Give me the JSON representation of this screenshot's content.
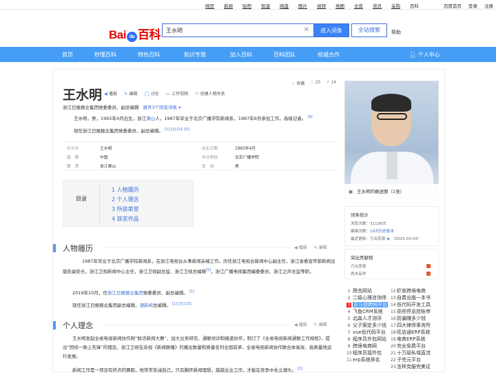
{
  "topbar": {
    "links": [
      "网页",
      "新闻",
      "贴吧",
      "知道",
      "网盘",
      "图片",
      "视频",
      "地图",
      "文库",
      "资讯",
      "采购",
      "百科"
    ],
    "right": [
      "百度首页",
      "登录",
      "注册"
    ]
  },
  "header": {
    "logo_text": "Bai",
    "logo_paw": "du",
    "logo_tail": "百科",
    "search_value": "王水明",
    "enter_label": "进入词条",
    "site_search_label": "全站搜索",
    "help_label": "帮助"
  },
  "nav": {
    "items": [
      "首页",
      "秒懂百科",
      "特色百科",
      "知识专题",
      "加入百科",
      "百科团队",
      "权威合作"
    ],
    "user": "个人中心"
  },
  "entry": {
    "title": "王水明",
    "tools": [
      "播报",
      "编辑",
      "讨论",
      "上传视频",
      "创建人物关系"
    ],
    "favorite": "收藏",
    "likes": "25",
    "shares": "14",
    "subtitle": "浙江日报报业集团党委委员、副总编辑",
    "same_name": "展开3个同名词条",
    "intro_1": "王水明，男，1965年4月出生，浙江",
    "intro_link": "萧山",
    "intro_2": "人，1987年毕业于北京广播学院新闻系，1987年8月参加工作。高级记者。",
    "intro_ref": "[4]",
    "intro_line2": "现任浙江日报报业集团党委委员、副总编辑。",
    "intro_line2_refs": "[1]  [3]  [13-15]"
  },
  "info": {
    "rows": [
      {
        "k1": "中文名",
        "v1": "王水明",
        "k2": "出生日期",
        "v2": "1965年4月"
      },
      {
        "k1": "国　籍",
        "v1": "中国",
        "k2": "毕业院校",
        "v2": "北京广播学院"
      },
      {
        "k1": "籍　贯",
        "v1": "浙江萧山",
        "k2": "性　别",
        "v2": "男"
      }
    ]
  },
  "toc": {
    "label": "目录",
    "items": [
      "1  人物履历",
      "2  个人理念",
      "3  所获荣誉",
      "4  获奖作品"
    ]
  },
  "sections": {
    "s1_title": "人物履历",
    "s1_p1": "1987年毕业于北京广播学院新闻系，在浙江电视台从事新闻采编工作。历任浙江电视台新闻中心副主任，浙江省委宣传部新闻出版处副处长，浙江卫视新闻中心主任，浙江卫视副总监、浙江卫视总编辑",
    "s1_p1_ref": "[5]",
    "s1_p1_tail": "，浙江广播电视集团编委委员、浙江之声总监等职。",
    "s1_p2a": "2019年10月，任",
    "s1_p2_link": "浙江日报报业集团",
    "s1_p2b": "党委委员、副总编辑。",
    "s1_p2_ref": "[1]",
    "s1_p3a": "现任浙江日报报业集团副总编辑，",
    "s1_p3_link": "潮新闻",
    "s1_p3b": "总编辑。",
    "s1_p3_refs": "[1]  [3]  [13]",
    "s2_title": "个人理念",
    "s2_p1": "王水明发起全省电视新闻协作网“鲜活新闻大赛”，加大业务研究、通联培训和报道协作，制订了《全省电视新闻通联工作规程》，提出“团结一致上先锋”的理念，浙江卫视在央视《新闻联播》的播出数量和质量名列全国前茅，全省电视新闻协作联合体高效、高质量地运行发展。",
    "s2_p2": "新闻工作是一项没有终点的赛跑，他常常告诫自己，只有胸怀新闻理想，兢兢业业工作，才能在竞争中永立潮头。",
    "s2_p2_ref": "[2]",
    "ops": [
      "播报",
      "编辑"
    ]
  },
  "sidebar": {
    "photo_caption": "王水明的概述图（1张）",
    "stats_title": "词条统计",
    "views": "浏览次数：31138次",
    "edits_pre": "编辑次数：",
    "edits_link": "19次历史版本",
    "updated_pre": "最近更新：",
    "updated_user": "万古蕊夜",
    "updated_date": "（2025-03-04）",
    "contrib_title": "突出贡献榜",
    "contributors": [
      "万古蕊夜",
      "西木有学"
    ]
  },
  "ads": {
    "left": [
      "爬虫网站",
      "二级心理咨询师",
      "亚马逊跨网平台",
      "飞鱼CRM系统",
      "北森人才测评",
      "父子案定多少钱",
      "vue低代码平台",
      "程序员外包网站",
      "跨境电商网",
      "程序员接外包",
      "erp系统排名"
    ],
    "right": [
      "虾皮跨境电商",
      "自费出版一本书",
      "低代码开发工具",
      "花呗停息挂账申",
      "防骗赚多少钱",
      "四大律师事务所",
      "旺店通ERP系统",
      "电商ERP系统",
      "完全免费平台",
      "十万级私域直流",
      "子完元平台",
      "怎样克服完美证"
    ],
    "hot_index": 2
  },
  "colors": {
    "nav_bg": "#459df5",
    "link": "#3b6fd9",
    "accent_bar": "#4f9cf5"
  }
}
